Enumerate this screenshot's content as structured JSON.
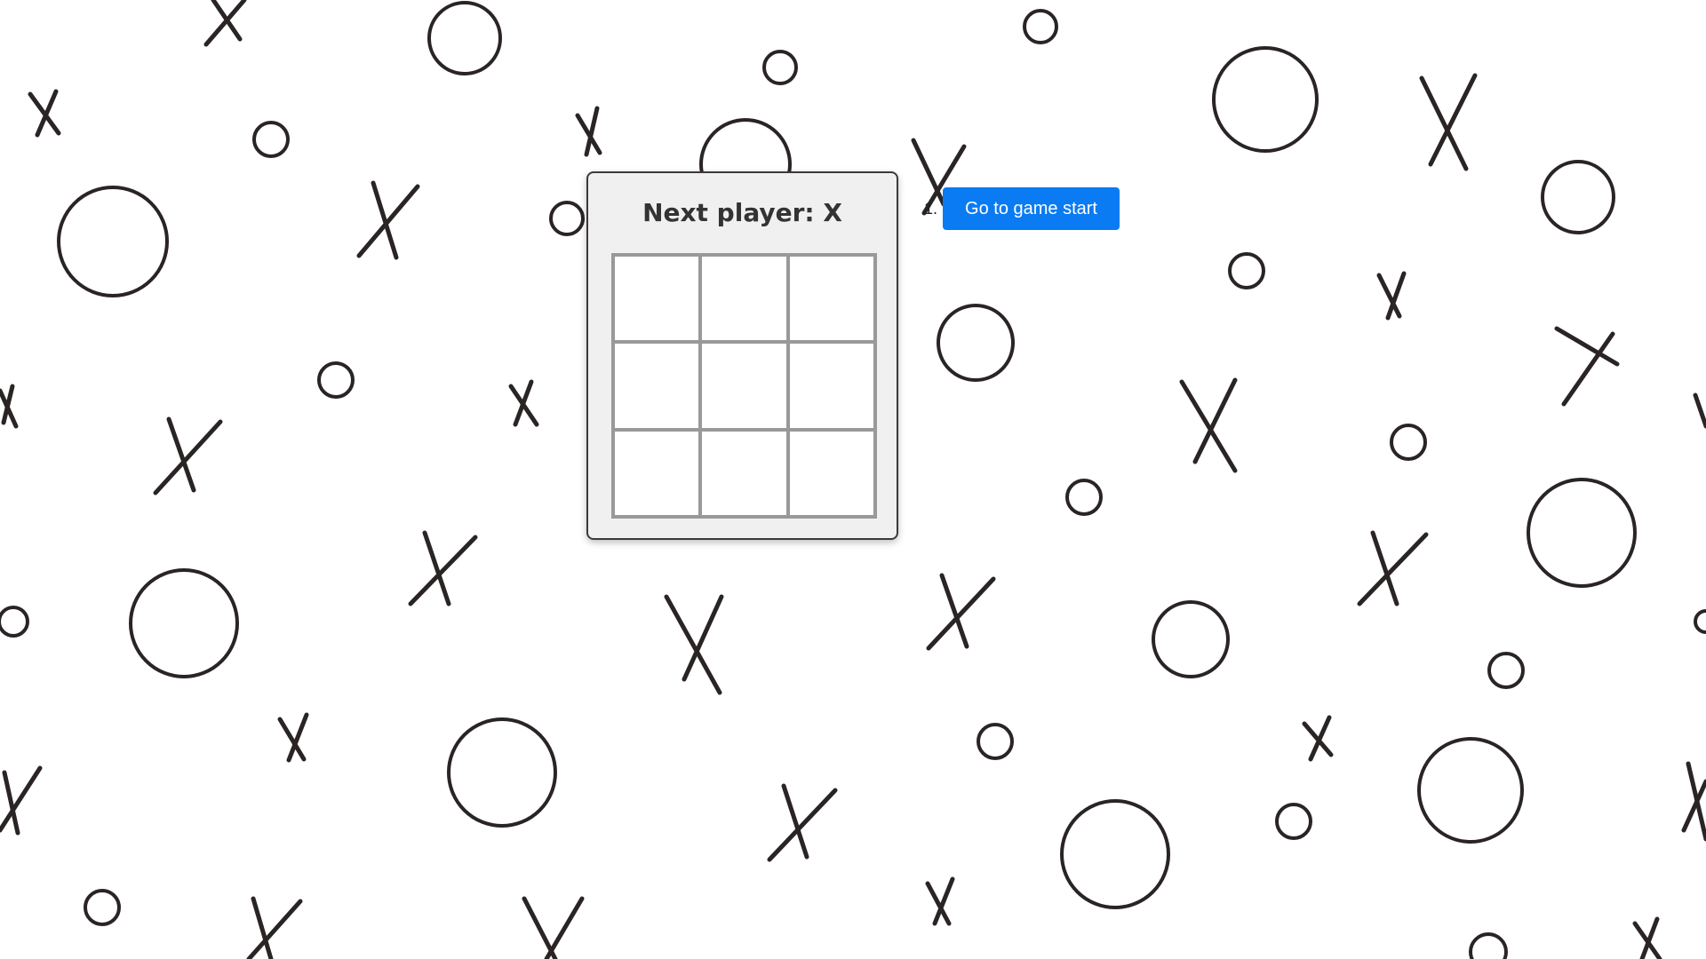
{
  "game": {
    "status": "Next player: X",
    "board": [
      "",
      "",
      "",
      "",
      "",
      "",
      "",
      "",
      ""
    ]
  },
  "history": {
    "moves": [
      {
        "index": "1.",
        "label": "Go to game start"
      }
    ]
  },
  "colors": {
    "button_bg": "#0a7bf2",
    "button_text": "#ffffff",
    "panel_bg": "#f0f0f0",
    "grid_line": "#999999"
  },
  "background": {
    "pattern": "hand-drawn x and o doodles",
    "icons": [
      "x-doodle-icon",
      "o-doodle-icon"
    ]
  }
}
